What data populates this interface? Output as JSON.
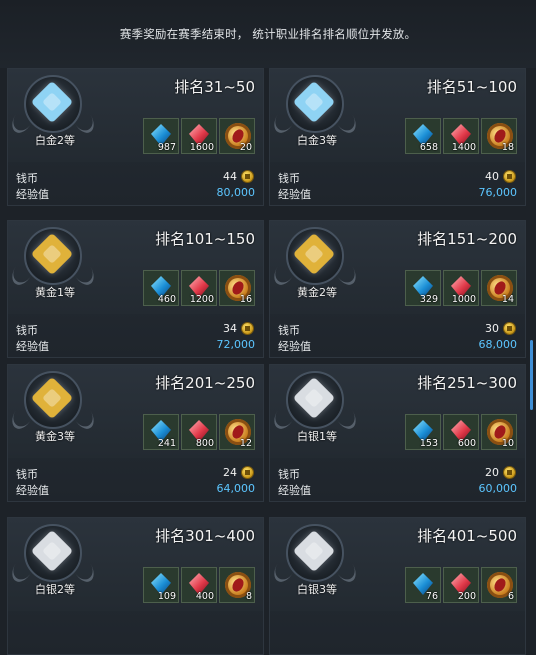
{
  "header": {
    "notice": "赛季奖励在赛季结束时， 统计职业排名排名顺位并发放。"
  },
  "labels": {
    "currency": "钱币",
    "exp": "经验值"
  },
  "cards": [
    {
      "rank": "排名31~50",
      "tier": "白金2等",
      "medal": "platinum-medal-icon",
      "gem_color": "#8fd3f4",
      "items": [
        {
          "icon": "blue-crystal-icon",
          "qty": "987"
        },
        {
          "icon": "red-crystal-icon",
          "qty": "1600"
        },
        {
          "icon": "gold-token-icon",
          "qty": "20"
        }
      ],
      "currency": "44",
      "exp": "80,000"
    },
    {
      "rank": "排名51~100",
      "tier": "白金3等",
      "medal": "platinum-medal-icon",
      "gem_color": "#8fd3f4",
      "items": [
        {
          "icon": "blue-crystal-icon",
          "qty": "658"
        },
        {
          "icon": "red-crystal-icon",
          "qty": "1400"
        },
        {
          "icon": "gold-token-icon",
          "qty": "18"
        }
      ],
      "currency": "40",
      "exp": "76,000"
    },
    {
      "rank": "排名101~150",
      "tier": "黄金1等",
      "medal": "gold-medal-icon",
      "gem_color": "#e0b23a",
      "items": [
        {
          "icon": "blue-crystal-icon",
          "qty": "460"
        },
        {
          "icon": "red-crystal-icon",
          "qty": "1200"
        },
        {
          "icon": "gold-token-icon",
          "qty": "16"
        }
      ],
      "currency": "34",
      "exp": "72,000"
    },
    {
      "rank": "排名151~200",
      "tier": "黄金2等",
      "medal": "gold-medal-icon",
      "gem_color": "#e0b23a",
      "items": [
        {
          "icon": "blue-crystal-icon",
          "qty": "329"
        },
        {
          "icon": "red-crystal-icon",
          "qty": "1000"
        },
        {
          "icon": "gold-token-icon",
          "qty": "14"
        }
      ],
      "currency": "30",
      "exp": "68,000"
    },
    {
      "rank": "排名201~250",
      "tier": "黄金3等",
      "medal": "gold-medal-icon",
      "gem_color": "#e0b23a",
      "items": [
        {
          "icon": "blue-crystal-icon",
          "qty": "241"
        },
        {
          "icon": "red-crystal-icon",
          "qty": "800"
        },
        {
          "icon": "gold-token-icon",
          "qty": "12"
        }
      ],
      "currency": "24",
      "exp": "64,000"
    },
    {
      "rank": "排名251~300",
      "tier": "白银1等",
      "medal": "silver-medal-icon",
      "gem_color": "#d9dde2",
      "items": [
        {
          "icon": "blue-crystal-icon",
          "qty": "153"
        },
        {
          "icon": "red-crystal-icon",
          "qty": "600"
        },
        {
          "icon": "gold-token-icon",
          "qty": "10"
        }
      ],
      "currency": "20",
      "exp": "60,000"
    },
    {
      "rank": "排名301~400",
      "tier": "白银2等",
      "medal": "silver-medal-icon",
      "gem_color": "#d9dde2",
      "items": [
        {
          "icon": "blue-crystal-icon",
          "qty": "109"
        },
        {
          "icon": "red-crystal-icon",
          "qty": "400"
        },
        {
          "icon": "gold-token-icon",
          "qty": "8"
        }
      ],
      "currency": "",
      "exp": ""
    },
    {
      "rank": "排名401~500",
      "tier": "白银3等",
      "medal": "silver-medal-icon",
      "gem_color": "#d9dde2",
      "items": [
        {
          "icon": "blue-crystal-icon",
          "qty": "76"
        },
        {
          "icon": "red-crystal-icon",
          "qty": "200"
        },
        {
          "icon": "gold-token-icon",
          "qty": "6"
        }
      ],
      "currency": "",
      "exp": ""
    }
  ]
}
